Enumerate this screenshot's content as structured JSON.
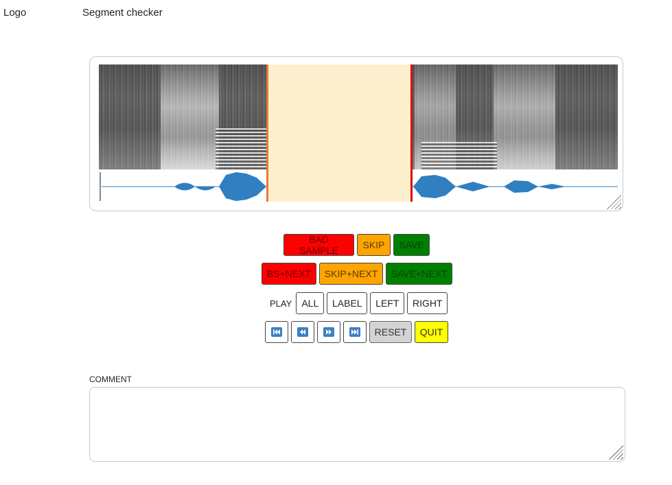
{
  "header": {
    "logo": "Logo",
    "title": "Segment checker"
  },
  "actions_row1": {
    "bad_sample": "BAD SAMPLE",
    "skip": "SKIP",
    "save": "SAVE"
  },
  "actions_row2": {
    "bs_next": "BS+NEXT",
    "skip_next": "SKIP+NEXT",
    "save_next": "SAVE+NEXT"
  },
  "play": {
    "label": "PLAY",
    "all": "ALL",
    "label_btn": "LABEL",
    "left": "LEFT",
    "right": "RIGHT"
  },
  "transport": {
    "icons": [
      "skip-to-start-icon",
      "rewind-icon",
      "fast-forward-icon",
      "skip-to-end-icon"
    ],
    "reset": "RESET",
    "quit": "QUIT"
  },
  "comment": {
    "label": "COMMENT",
    "value": ""
  },
  "colors": {
    "bad": "#ff0000",
    "skip": "#ffa500",
    "save": "#008000",
    "reset": "#d3d3d3",
    "quit": "#ffff00",
    "selection_fill": "#fdefcd",
    "selection_left": "#e57b34",
    "selection_right": "#e00000",
    "waveform": "#2f7fc1",
    "icon_blue": "#3a7fc4"
  }
}
